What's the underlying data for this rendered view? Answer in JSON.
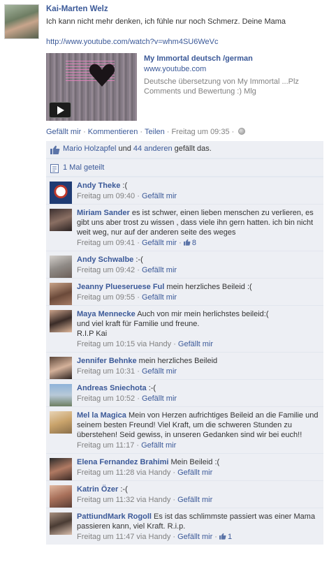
{
  "post": {
    "author": "Kai-Marten Welz",
    "text": "Ich kann nicht mehr denken, ich fühle nur noch Schmerz. Deine Mama",
    "link": "http://www.youtube.com/watch?v=whm4SU6WeVc",
    "attachment": {
      "title": "My Immortal deutsch /german",
      "domain": "www.youtube.com",
      "description": "Deutsche übersetzung von My Immortal ...Plz Comments und Bewertung :) Mlg"
    },
    "actions": {
      "like": "Gefällt mir",
      "comment": "Kommentieren",
      "share": "Teilen",
      "time": "Freitag um 09:35"
    }
  },
  "likes": {
    "first_name": "Mario Holzapfel",
    "and": "und",
    "others": "44 anderen",
    "suffix": "gefällt das."
  },
  "shares": {
    "text": "1 Mal geteilt"
  },
  "comments": [
    {
      "name": "Andy Theke",
      "text": ":(",
      "time": "Freitag um 09:40",
      "via": "",
      "like": "Gefällt mir",
      "likes": ""
    },
    {
      "name": "Miriam Sander",
      "text": "es ist schwer, einen lieben menschen zu verlieren, es gibt uns aber trost zu wissen , dass viele ihn gern hatten. ich bin nicht weit weg, nur auf der anderen seite des weges",
      "time": "Freitag um 09:41",
      "via": "",
      "like": "Gefällt mir",
      "likes": "8"
    },
    {
      "name": "Andy Schwalbe",
      "text": ":-(",
      "time": "Freitag um 09:42",
      "via": "",
      "like": "Gefällt mir",
      "likes": ""
    },
    {
      "name": "Jeanny Plueseruese Ful",
      "text": "mein herzliches Beileid :(",
      "time": "Freitag um 09:55",
      "via": "",
      "like": "Gefällt mir",
      "likes": ""
    },
    {
      "name": "Maya Mennecke",
      "text": "Auch von mir mein herlichstes beileid:(\nund viel kraft für Familie und freune.\nR.I.P Kai",
      "time": "Freitag um 10:15",
      "via": "via Handy",
      "like": "Gefällt mir",
      "likes": ""
    },
    {
      "name": "Jennifer Behnke",
      "text": "mein herzliches Beileid",
      "time": "Freitag um 10:31",
      "via": "",
      "like": "Gefällt mir",
      "likes": ""
    },
    {
      "name": "Andreas Sniechota",
      "text": ":-(",
      "time": "Freitag um 10:52",
      "via": "",
      "like": "Gefällt mir",
      "likes": ""
    },
    {
      "name": "Mel la Magica",
      "text": "Mein von Herzen aufrichtiges Beileid an die Familie und seinem besten Freund! Viel Kraft, um die schweren Stunden zu überstehen! Seid gewiss, in unseren Gedanken sind wir bei euch!!",
      "time": "Freitag um 11:17",
      "via": "",
      "like": "Gefällt mir",
      "likes": ""
    },
    {
      "name": "Elena Fernandez Brahimi",
      "text": "Mein Beileid :(",
      "time": "Freitag um 11:28",
      "via": "via Handy",
      "like": "Gefällt mir",
      "likes": ""
    },
    {
      "name": "Katrin Özer",
      "text": ":-(",
      "time": "Freitag um 11:32",
      "via": "via Handy",
      "like": "Gefällt mir",
      "likes": ""
    },
    {
      "name": "PattiundMark Rogoll",
      "text": "Es ist das schlimmste passiert was einer Mama passieren kann, viel Kraft. R.i.p.",
      "time": "Freitag um 11:47",
      "via": "via Handy",
      "like": "Gefällt mir",
      "likes": "1"
    }
  ],
  "colors": {
    "link": "#3b5998",
    "muted": "#808080",
    "ufi_bg": "#edeff4"
  },
  "icons": {
    "like": "thumbs-up-icon",
    "share": "share-icon",
    "globe": "globe-icon",
    "play": "play-icon"
  }
}
